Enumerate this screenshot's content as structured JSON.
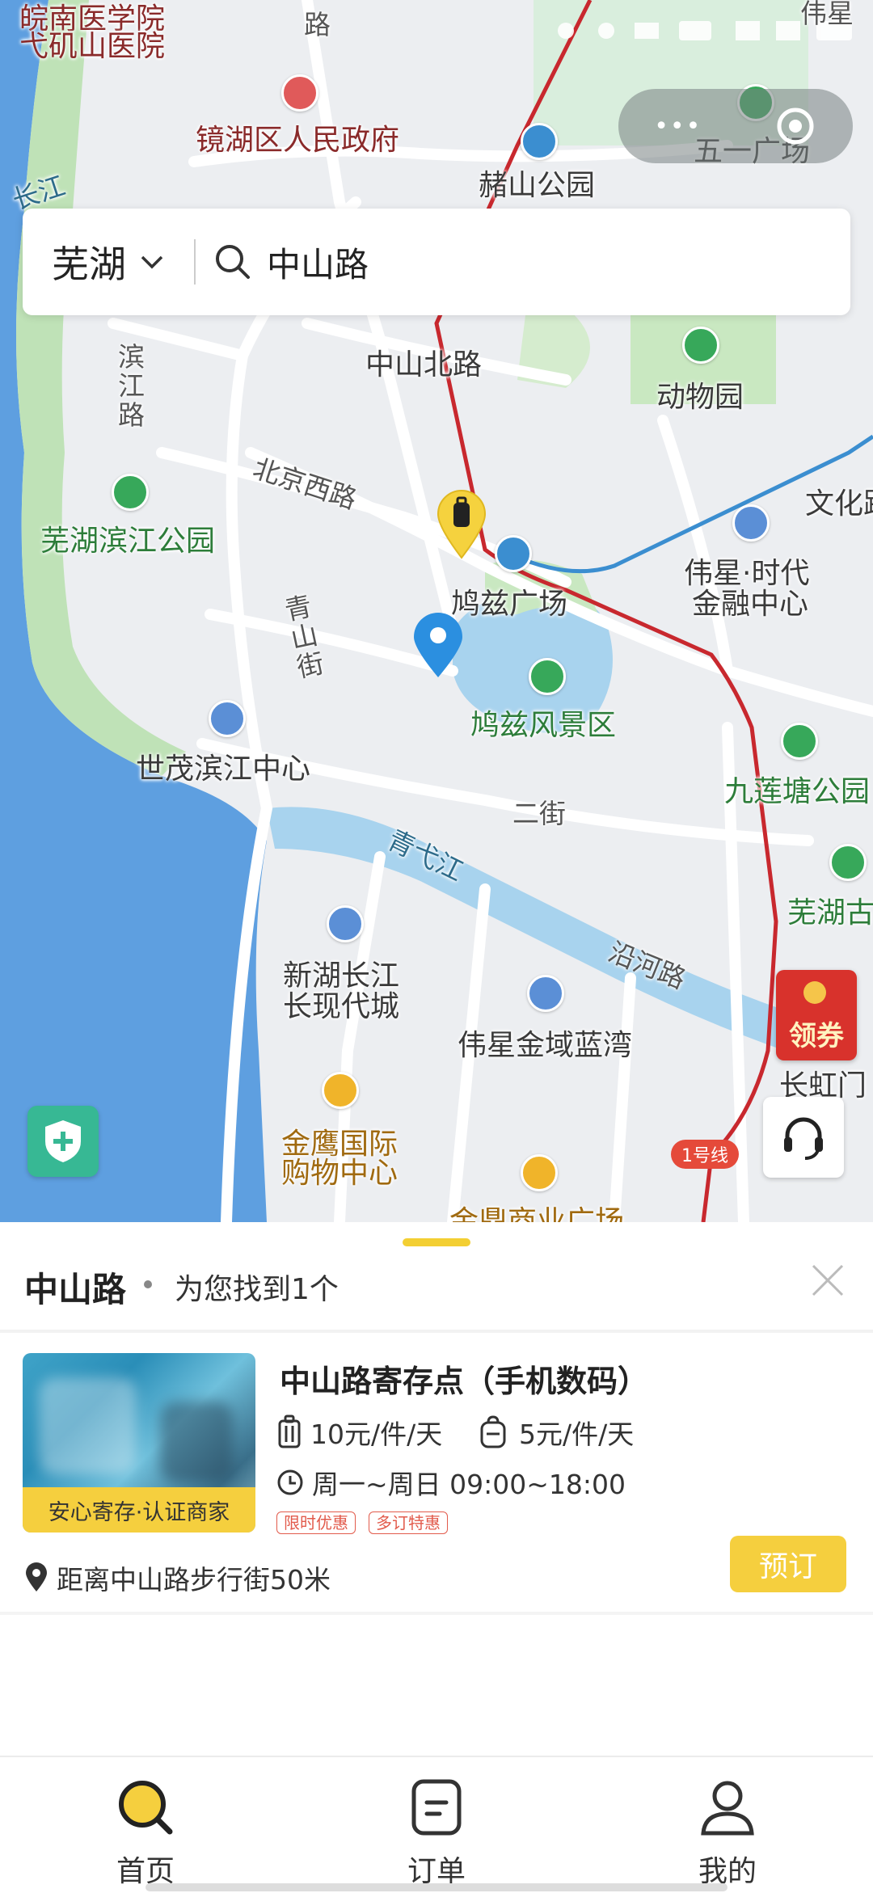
{
  "status_bar": {
    "text": " "
  },
  "capsule": {
    "more": "•••"
  },
  "search": {
    "city": "芜湖",
    "query": "中山路"
  },
  "map": {
    "labels": {
      "l1": "皖南医学院",
      "l2": "弋矶山医院",
      "l3": "镜湖区人民政府",
      "l4": "赭山公园",
      "l5": "五一广场",
      "l6": "长江",
      "l7": "中山北路",
      "l8": "动物园",
      "l9": "滨江路",
      "l10": "北京西路",
      "l11": "芜湖滨江公园",
      "l12": "文化路",
      "l13": "伟星·时代",
      "l14": "金融中心",
      "l15": "鸠兹广场",
      "l16": "青山街",
      "l17": "鸠兹风景区",
      "l18": "世茂滨江中心",
      "l19": "九莲塘公园",
      "l20": "二街",
      "l21": "青弋江",
      "l22": "芜湖古",
      "l23": "新湖长江",
      "l24": "长现代城",
      "l25": "沿河路",
      "l26": "伟星金域蓝湾",
      "l27": "长虹门",
      "l28": "金鹰国际",
      "l29": "购物中心",
      "l30": "金鼎商业广场",
      "l31": "路",
      "l32": "伟星"
    },
    "metro_badge": "1号线",
    "coupon": "领券"
  },
  "results": {
    "title": "中山路",
    "count": "为您找到1个",
    "store": {
      "name": "中山路寄存点（手机数码）",
      "badge": "安心寄存·认证商家",
      "price_luggage": "10元/件/天",
      "price_bag": "5元/件/天",
      "hours": "周一~周日 09:00~18:00",
      "tags": [
        "限时优惠",
        "多订特惠"
      ],
      "distance": "距离中山路步行街50米",
      "book": "预订"
    }
  },
  "tabbar": {
    "home": "首页",
    "orders": "订单",
    "mine": "我的"
  }
}
